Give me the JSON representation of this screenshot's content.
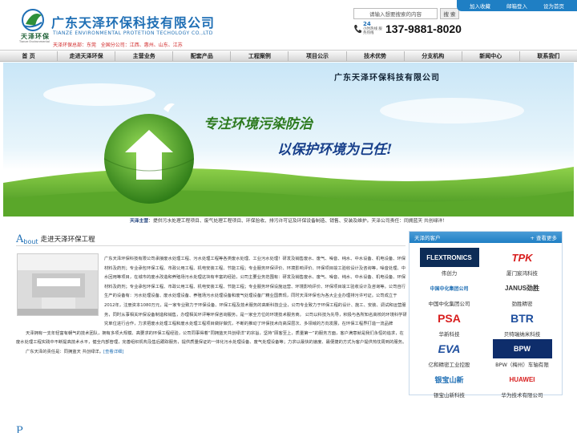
{
  "topbar": {
    "add_fav": "加入收藏",
    "contact": "邮箱登入",
    "home_set": "设为首页"
  },
  "header": {
    "logo_text": "天泽环保",
    "logo_sub": "Tianze Environmental",
    "company_cn": "广东天泽环保科技有限公司",
    "company_en": "TIANZE ENVIRONMENTAL PROTETION TECHOLOGY CO.,LTD",
    "branches_label": "天泽环保总部：东莞",
    "branches_list": "全国分公司：江西、惠州、山东、江苏",
    "search_placeholder": "请输入想要搜索的内容",
    "search_button": "搜 索",
    "hotline_tag_top": "24",
    "hotline_tag": "小时热线 服务热线",
    "hotline_number": "137-9881-8020"
  },
  "nav": [
    "首 页",
    "走进天泽环保",
    "主营业务",
    "配套产品",
    "工程案例",
    "项目公示",
    "技术优势",
    "分支机构",
    "新闻中心",
    "联系我们"
  ],
  "banner": {
    "company": "广东天泽环保科技有限公司",
    "slogan1": "专注环境污染防治",
    "slogan2": "以保护环境为己任!"
  },
  "intro": {
    "label": "天泽主营",
    "text": "：提供污水处理工程项目、废气处理工程项目、环保验收、排污许可证及环保设备制造、销售、安装及维护。天泽公司责任：同拥蓝天 共创绿洋！"
  },
  "about": {
    "big_letter": "A",
    "rest_letters": "bout",
    "title": "走进天泽环保工程",
    "para1": "广东天泽环保科技有限公司承接废水处理工程、污水处理工程等各类废水处理、工业污水处理！研发及销售废水、废气、噪音、纯水、中水设备、机电设备、环保材料及药剂；专业承包环保工程、市政公用工程、机电安装工程、节能工程；专业服务环保评价、环境影响评价、环保项目竣工验收设计及咨询等，噪音处理、中水回用等项目，在城市的废水改造和养殖场污水处理这块有丰富的经验，公司主要业务范围有：研发及销售废水、废气、噪音、纯水、中水设备、机电设备、环保材料及药剂；专业承包环保工程、市政公用工程、机电安装工程、节能工程；专业服务环保设施运营、环境影响评价、环保项目竣工验收设计及咨询等。公司自行生产的设备有：污水处理设备、废水处理设备、养殖场污水处理设备和废气处理设备厂精业国表现，同时天泽环保也为各大企业办理排污许可证。公司成立于2012年，注册资本1080万元，是一家专业致力于环保设备、环保工程及技术服务的高新科技企业，公司专业致力于环保工程的设计、施工、安装、调试和运营服务，同时从事相关环保设备制造和销售，办理相关环评等环保咨询服务，是一家全方位的环境技术服务商。 公司以科技为先导，积极与各所知名高校的环境科学研究单位进行合作，力求把废水处理工程和废水处理工程项目做好做优，不断的推动了环保技术向高深层次、多领域的方向发展，在环保工程界打造一流品牌",
    "para2": "天泽拥有一支年轻富有朝气的技术团队，拥有多项大规模、高要求的环保工程经验，公司同事得着“同拥蓝天共创绿洋”的宗旨，坚持“顾客至上，质量第一”的服务方面，客户满意就是我们永恒的追求，在废水处理工程实践中不断提高技术水平，健全内部管理，完善组织机构及售后跟踪服务，提供质量保证的一体化污水处理设备、废气处理设备等；力求以最快的速度、最便捷的方式为客户提供热忱周到的服务。",
    "para3": "广东天泽的责任是：同拥蓝天 共创绿洋。",
    "more": "[查看详细]"
  },
  "bottom_head": "P",
  "clients": {
    "title": "天泽的客户",
    "more": "+ 查看更多",
    "items": [
      {
        "logo": "FLEXTRONICS",
        "name": "伟创力"
      },
      {
        "logo": "TPK",
        "name": "厦门宸鸿科技"
      },
      {
        "logo": "中国中化集团公司",
        "name": "中国中化集团公司"
      },
      {
        "logo": "JANUS劲胜",
        "name": "劲胜精密"
      },
      {
        "logo": "PSA",
        "name": "华新科技"
      },
      {
        "logo": "BTR",
        "name": "贝特瑞纳米科技"
      },
      {
        "logo": "EVA",
        "name": "亿和精密工业控股"
      },
      {
        "logo": "BPW",
        "name": "BPW（梅州）车轴有限"
      },
      {
        "logo": "银宝山新",
        "name": "银宝山新科技"
      },
      {
        "logo": "HUAWEI",
        "name": "华为技术有限公司"
      }
    ]
  },
  "colors": {
    "brand_blue": "#1f6fb5",
    "accent_red": "#d12a2a",
    "grass_green": "#4a9a23"
  }
}
